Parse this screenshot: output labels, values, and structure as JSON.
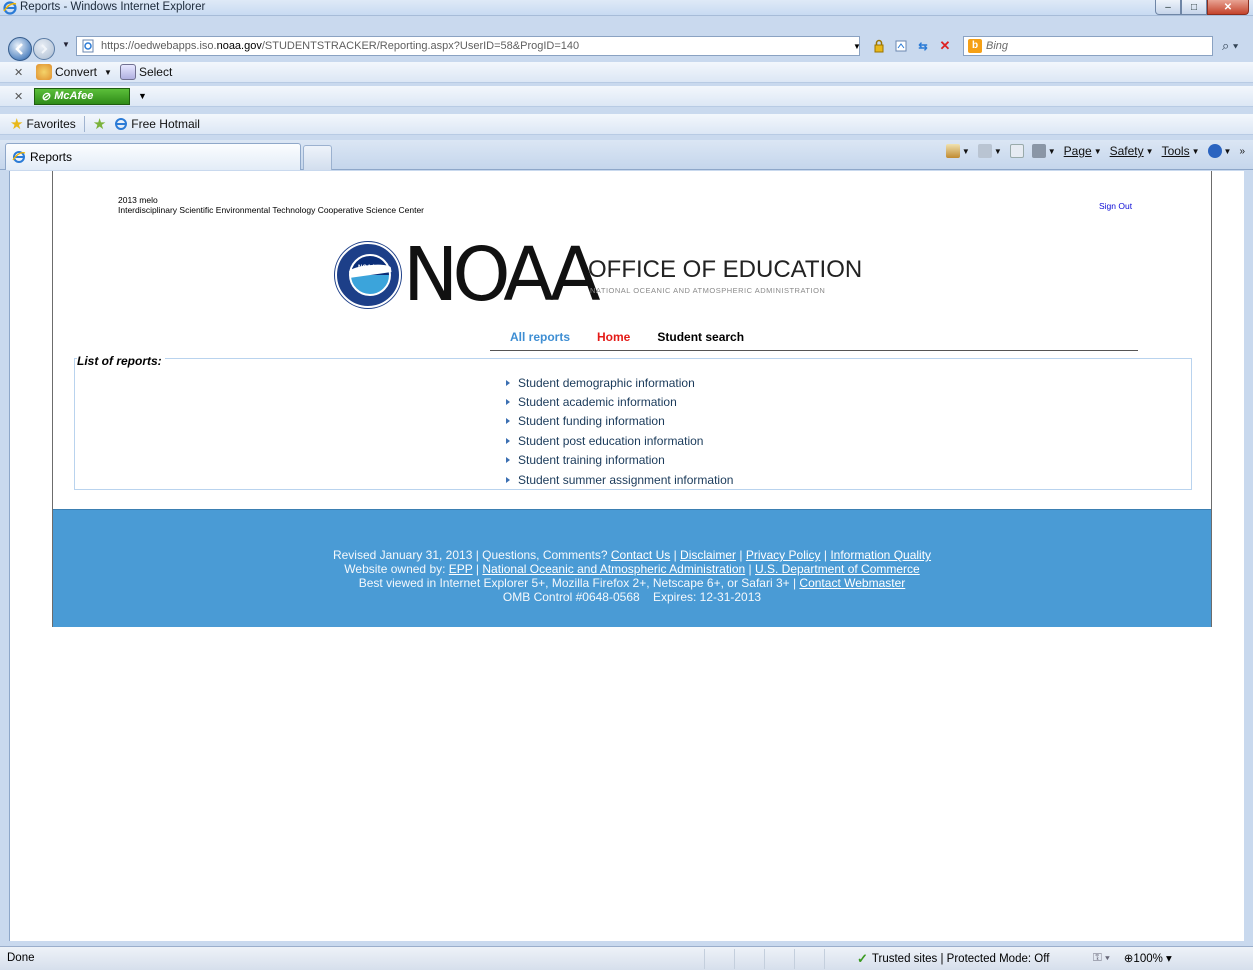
{
  "window": {
    "title": "Reports - Windows Internet Explorer",
    "controls": {
      "minimize": "–",
      "maximize": "□",
      "close": "✕"
    }
  },
  "address_bar": {
    "url_prefix": "https://oedwebapps.iso.",
    "url_domain": "noaa.gov",
    "url_suffix": "/STUDENTSTRACKER/Reporting.aspx?UserID=58&ProgID=140",
    "search_placeholder": "Bing"
  },
  "toolbars": {
    "convert_label": "Convert",
    "select_label": "Select",
    "mcafee_label": "McAfee",
    "favorites_label": "Favorites",
    "hotmail_label": "Free Hotmail"
  },
  "tab": {
    "label": "Reports"
  },
  "command_bar": {
    "page_label": "Page",
    "safety_label": "Safety",
    "tools_label": "Tools"
  },
  "header": {
    "user_line": "2013 melo",
    "org_line": "Interdisciplinary Scientific Environmental Technology Cooperative Science Center",
    "sign_out": "Sign Out"
  },
  "logo": {
    "noaa": "NOAA",
    "office": "OFFICE OF EDUCATION",
    "subtitle": "NATIONAL OCEANIC AND ATMOSPHERIC ADMINISTRATION",
    "seal_text": "NOAA"
  },
  "nav": {
    "all_reports": "All reports",
    "home": "Home",
    "student_search": "Student search"
  },
  "reports": {
    "label": "List of reports:",
    "items": [
      "Student demographic information",
      "Student academic information",
      "Student funding information",
      "Student post education information",
      "Student training information",
      "Student summer assignment information"
    ]
  },
  "footer": {
    "revised": "Revised January 31, 2013 | Questions, Comments? ",
    "contact_us": "Contact Us",
    "disclaimer": "Disclaimer",
    "privacy": "Privacy Policy",
    "info_quality": "Information Quality",
    "owned_by": "Website owned by: ",
    "epp": "EPP",
    "noaa_full": "National Oceanic and Atmospheric Administration",
    "commerce": "U.S. Department of Commerce",
    "best_viewed": "Best viewed in Internet Explorer 5+, Mozilla Firefox 2+, Netscape 6+, or Safari 3+ | ",
    "contact_webmaster": "Contact Webmaster",
    "omb": "OMB Control #0648-0568    Expires: 12-31-2013"
  },
  "status_bar": {
    "status": "Done",
    "zone": "Trusted sites | Protected Mode: Off",
    "zoom": "100%"
  }
}
